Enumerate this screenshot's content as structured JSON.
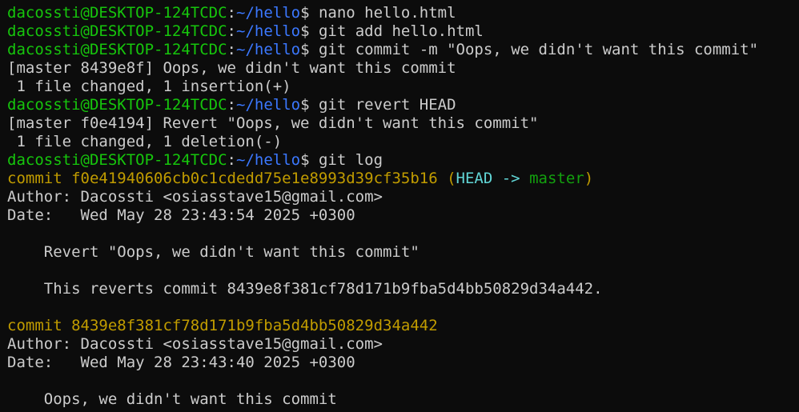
{
  "prompt": {
    "user_host": "dacossti@DESKTOP-124TCDC",
    "sep": ":",
    "path": "~/hello",
    "symbol": "$"
  },
  "lines": {
    "cmd1": " nano hello.html",
    "cmd2": " git add hello.html",
    "cmd3": " git commit -m \"Oops, we didn't want this commit\"",
    "out3a": "[master 8439e8f] Oops, we didn't want this commit",
    "out3b": " 1 file changed, 1 insertion(+)",
    "cmd4": " git revert HEAD",
    "out4a": "[master f0e4194] Revert \"Oops, we didn't want this commit\"",
    "out4b": " 1 file changed, 1 deletion(-)",
    "cmd5": " git log"
  },
  "log": {
    "commit1": {
      "label": "commit ",
      "hash": "f0e41940606cb0c1cdedd75e1e8993d39cf35b16",
      "ref_open": " (",
      "head": "HEAD",
      "arrow": " -> ",
      "branch": "master",
      "ref_close": ")",
      "author": "Author: Dacossti <osiasstave15@gmail.com>",
      "date": "Date:   Wed May 28 23:43:54 2025 +0300",
      "message": "    Revert \"Oops, we didn't want this commit\"",
      "body": "    This reverts commit 8439e8f381cf78d171b9fba5d4bb50829d34a442."
    },
    "commit2": {
      "label": "commit ",
      "hash": "8439e8f381cf78d171b9fba5d4bb50829d34a442",
      "author": "Author: Dacossti <osiasstave15@gmail.com>",
      "date": "Date:   Wed May 28 23:43:40 2025 +0300",
      "message": "    Oops, we didn't want this commit"
    }
  }
}
